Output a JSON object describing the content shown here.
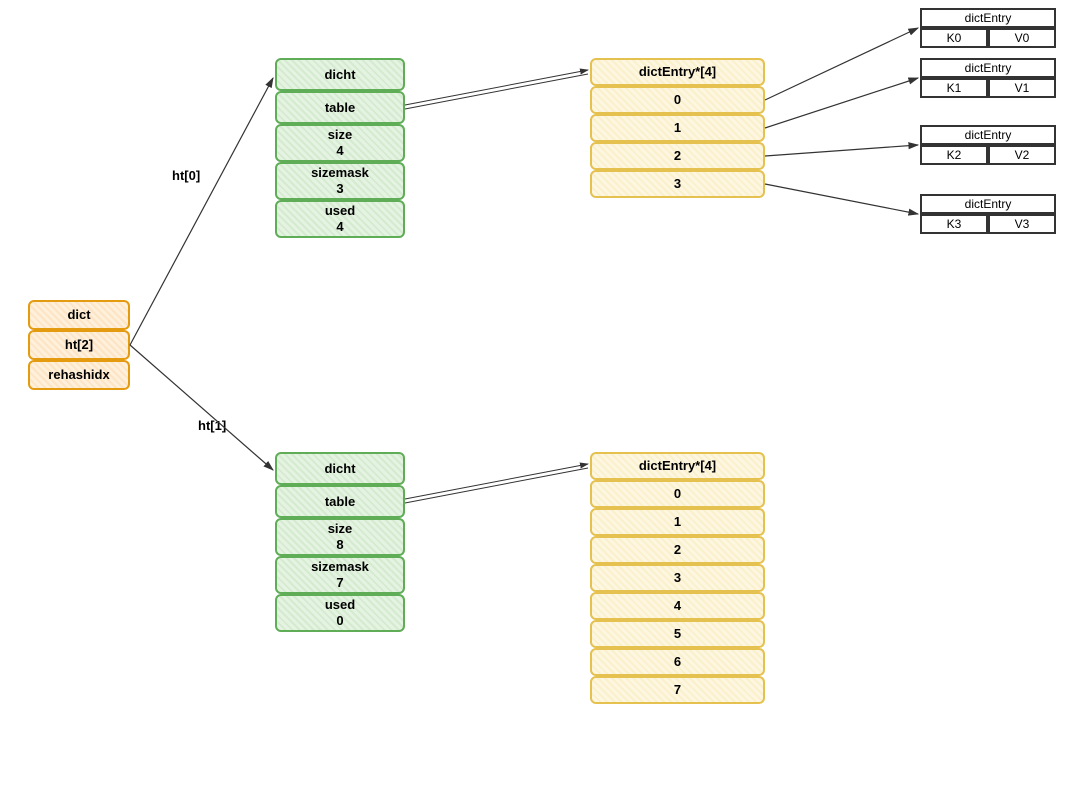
{
  "dict": {
    "title": "dict",
    "ht": "ht[2]",
    "rehashidx": "rehashidx"
  },
  "labels": {
    "ht0": "ht[0]",
    "ht1": "ht[1]"
  },
  "dicht0": {
    "title": "dicht",
    "table": "table",
    "size_label": "size",
    "size_val": "4",
    "sizemask_label": "sizemask",
    "sizemask_val": "3",
    "used_label": "used",
    "used_val": "4"
  },
  "dicht1": {
    "title": "dicht",
    "table": "table",
    "size_label": "size",
    "size_val": "8",
    "sizemask_label": "sizemask",
    "sizemask_val": "7",
    "used_label": "used",
    "used_val": "0"
  },
  "table0": {
    "header": "dictEntry*[4]",
    "slots": [
      "0",
      "1",
      "2",
      "3"
    ]
  },
  "table1": {
    "header": "dictEntry*[4]",
    "slots": [
      "0",
      "1",
      "2",
      "3",
      "4",
      "5",
      "6",
      "7"
    ]
  },
  "entries": [
    {
      "title": "dictEntry",
      "k": "K0",
      "v": "V0"
    },
    {
      "title": "dictEntry",
      "k": "K1",
      "v": "V1"
    },
    {
      "title": "dictEntry",
      "k": "K2",
      "v": "V2"
    },
    {
      "title": "dictEntry",
      "k": "K3",
      "v": "V3"
    }
  ]
}
